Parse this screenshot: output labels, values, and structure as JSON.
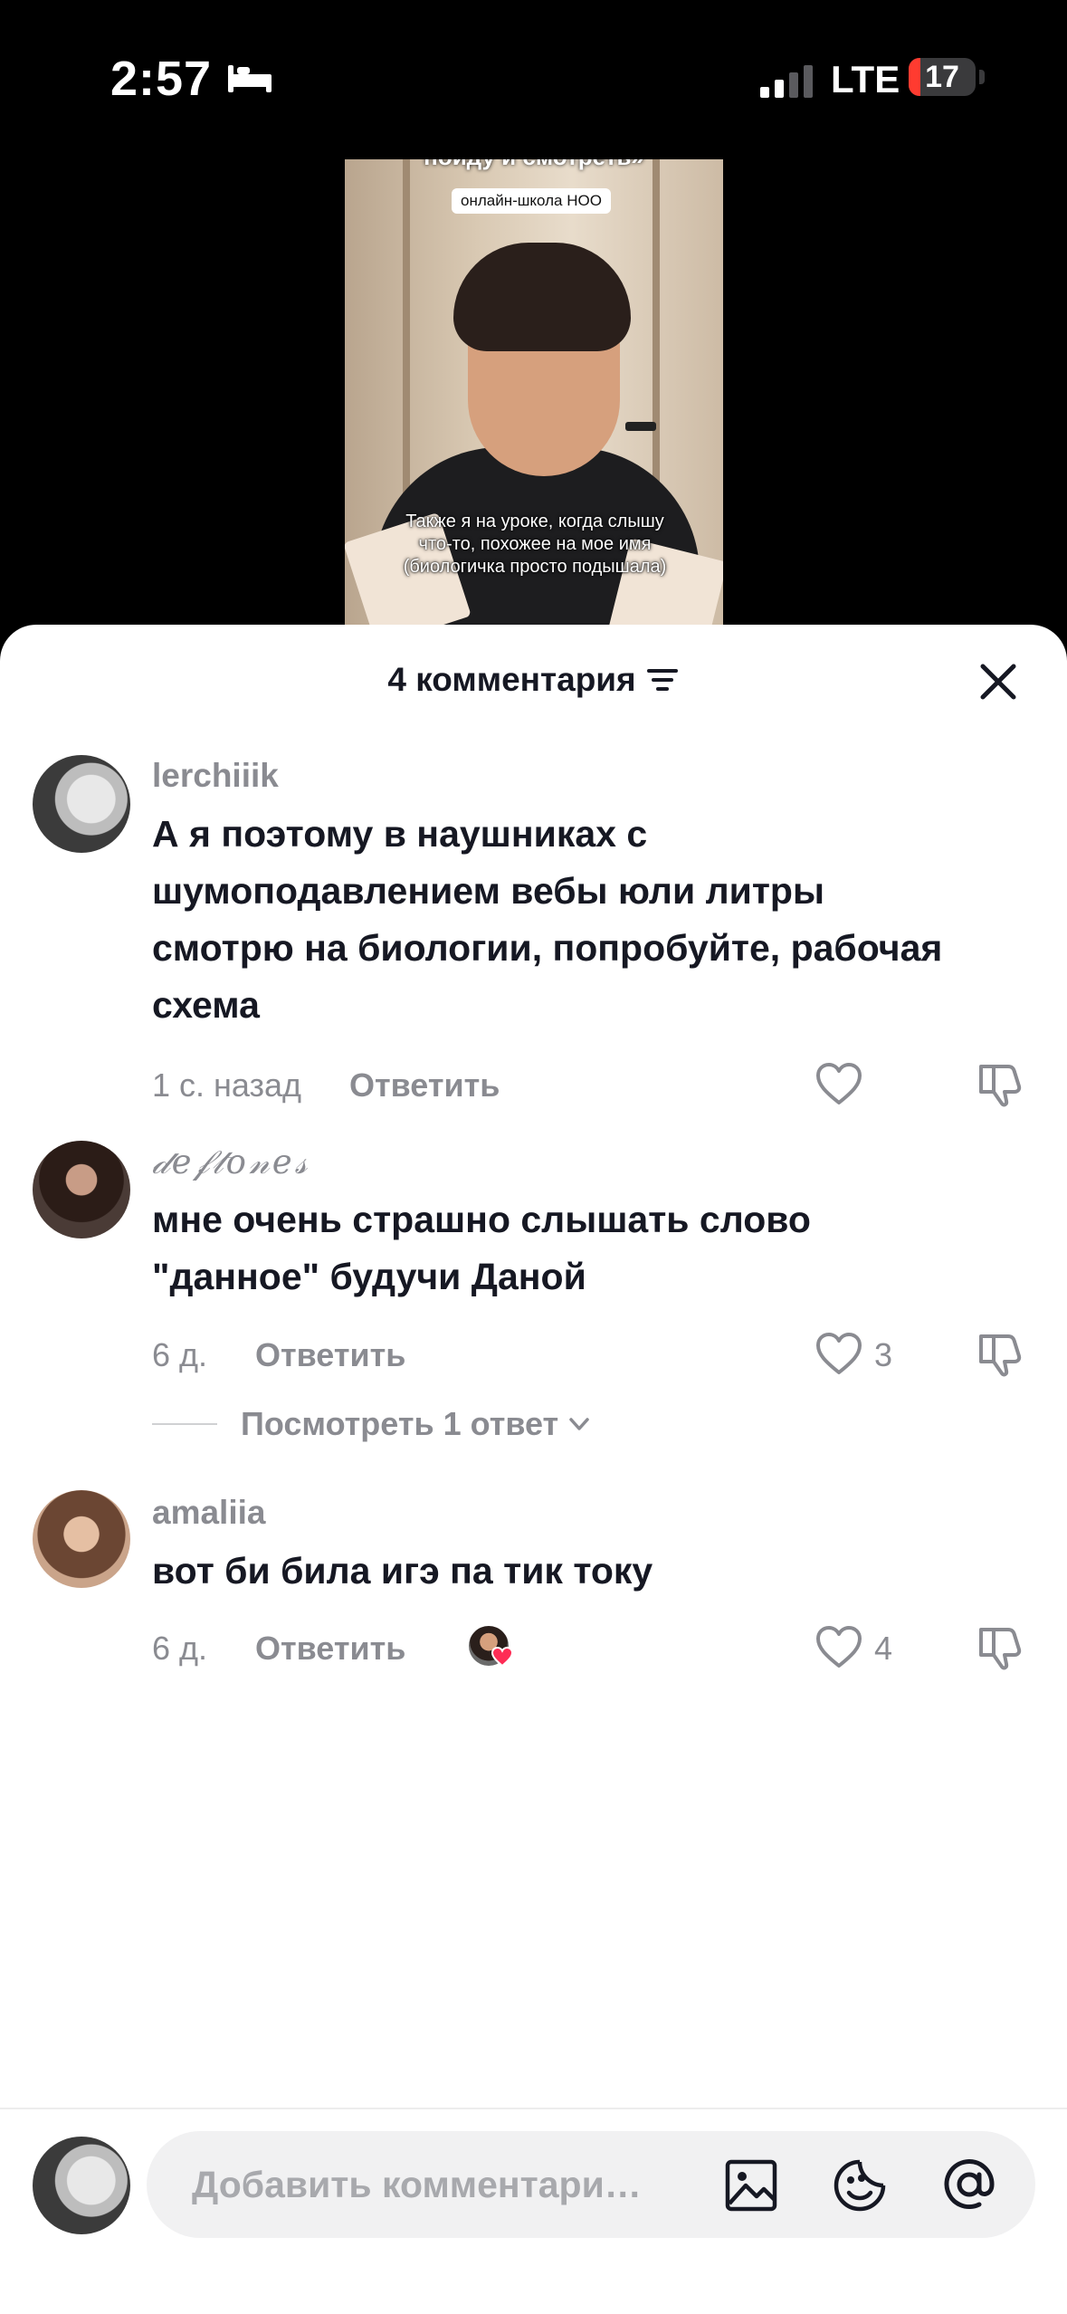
{
  "status_bar": {
    "time": "2:57",
    "network": "LTE",
    "battery": "17",
    "battery_level_percent": 17
  },
  "video": {
    "top_caption": "пойду и смотреть»",
    "tag": "онлайн-школа НОО",
    "caption": "Также я на уроке, когда слышу что-то, похожее на мое имя (биологичка просто подышала)"
  },
  "sheet": {
    "title": "4 комментария",
    "filter_icon": "filter-icon",
    "close_icon": "close-icon"
  },
  "comments": [
    {
      "username": "lerchiiik",
      "text": "А я поэтому в наушниках с шумоподавлением вебы юли литры смотрю на биологии, попробуйте, рабочая схема",
      "time": "1 с. назад",
      "reply": "Ответить",
      "likes": ""
    },
    {
      "username": "𝒹𝑒𝒻𝓉𝑜𝓃𝑒𝓈",
      "text": "мне очень страшно слышать слово \"данное\" будучи Даной",
      "time": "6 д.",
      "reply": "Ответить",
      "likes": "3",
      "view_replies": "Посмотреть 1 ответ"
    },
    {
      "username": "amaliia",
      "text": "вот би била игэ па тик току",
      "time": "6 д.",
      "reply": "Ответить",
      "likes": "4"
    }
  ],
  "input": {
    "placeholder": "Добавить комментари…"
  },
  "colors": {
    "text_primary": "#161823",
    "text_secondary": "#8a8b91",
    "heart_red": "#fe2c55"
  }
}
